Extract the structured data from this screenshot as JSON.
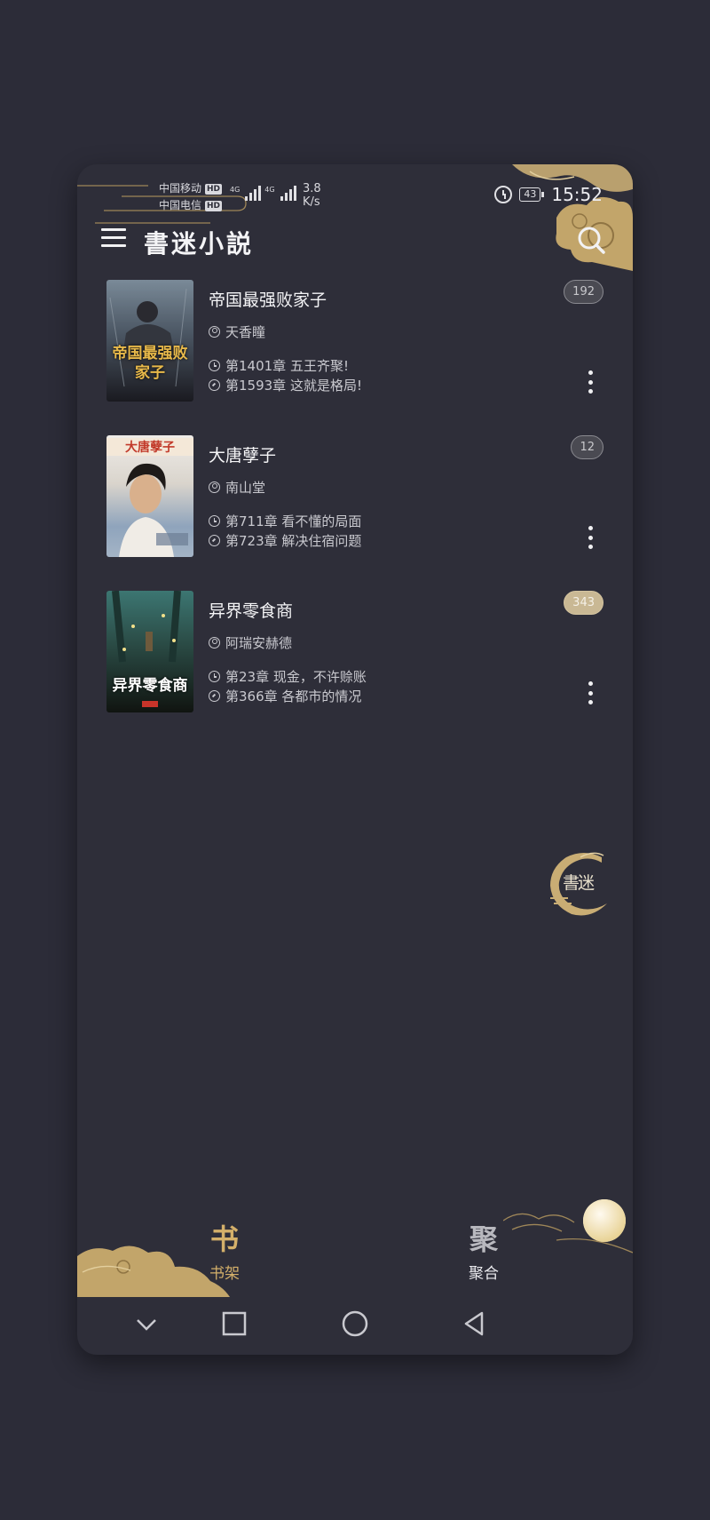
{
  "status_bar": {
    "carrier1": "中国移动",
    "carrier2": "中国电信",
    "hd_label": "HD",
    "net_type": "4G",
    "speed_value": "3.8",
    "speed_unit": "K/s",
    "battery": "43",
    "time": "15:52"
  },
  "app_bar": {
    "title": "書迷小説",
    "menu_icon": "menu-icon",
    "search_icon": "search-icon"
  },
  "books": [
    {
      "title": "帝国最强败家子",
      "author": "天香瞳",
      "last_read": "第1401章 五王齐聚!",
      "latest": "第1593章 这就是格局!",
      "badge": "192",
      "badge_style": "grey",
      "cover_text": "帝国最强败家子",
      "cover_colors": [
        "#5a6a78",
        "#1c1c22"
      ]
    },
    {
      "title": "大唐孽子",
      "author": "南山堂",
      "last_read": "第711章 看不懂的局面",
      "latest": "第723章 解决住宿问题",
      "badge": "12",
      "badge_style": "grey",
      "cover_text": "大唐孽子",
      "cover_colors": [
        "#e9e6e2",
        "#8aa0b8"
      ]
    },
    {
      "title": "异界零食商",
      "author": "阿瑞安赫德",
      "last_read": "第23章 现金，不许赊账",
      "latest": "第366章 各都市的情况",
      "badge": "343",
      "badge_style": "gold",
      "cover_text": "异界零食商",
      "cover_colors": [
        "#2e5a58",
        "#0e1210"
      ]
    }
  ],
  "floating_button": {
    "label": "書迷"
  },
  "bottom_nav": [
    {
      "glyph": "书",
      "label": "书架",
      "active": true
    },
    {
      "glyph": "聚",
      "label": "聚合",
      "active": false
    }
  ],
  "system_nav": [
    "chevron-down-icon",
    "square-icon",
    "circle-home-icon",
    "triangle-back-icon"
  ],
  "colors": {
    "background": "#2c2c38",
    "panel": "#2e2e39",
    "gold": "#c9ad74",
    "active_nav": "#d4b06a"
  }
}
